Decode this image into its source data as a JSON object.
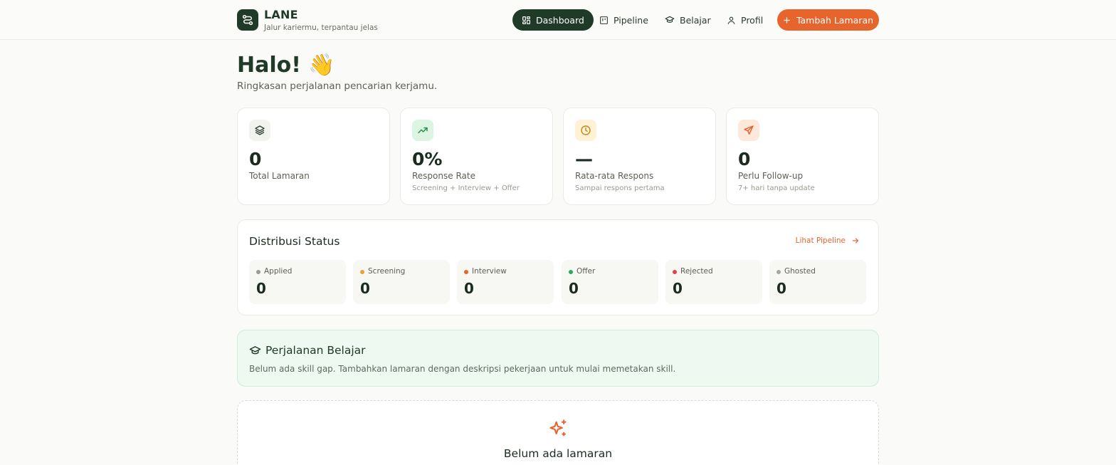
{
  "brand": {
    "name": "LANE",
    "tagline": "Jalur kariermu, terpantau jelas"
  },
  "nav": {
    "items": [
      {
        "label": "Dashboard",
        "icon": "dashboard-grid-icon",
        "active": true
      },
      {
        "label": "Pipeline",
        "icon": "kanban-icon",
        "active": false
      },
      {
        "label": "Belajar",
        "icon": "graduation-cap-icon",
        "active": false
      },
      {
        "label": "Profil",
        "icon": "user-icon",
        "active": false
      }
    ],
    "cta": {
      "label": "Tambah Lamaran",
      "icon": "plus-icon"
    }
  },
  "greeting": {
    "title": "Halo! 👋",
    "subtitle": "Ringkasan perjalanan pencarian kerjamu."
  },
  "stats": [
    {
      "value": "0",
      "label": "Total Lamaran",
      "sub": "",
      "icon": "layers-icon"
    },
    {
      "value": "0%",
      "label": "Response Rate",
      "sub": "Screening + Interview + Offer",
      "icon": "trending-up-icon"
    },
    {
      "value": "—",
      "label": "Rata-rata Respons",
      "sub": "Sampai respons pertama",
      "icon": "clock-icon"
    },
    {
      "value": "0",
      "label": "Perlu Follow-up",
      "sub": "7+ hari tanpa update",
      "icon": "send-icon"
    }
  ],
  "distribution": {
    "title": "Distribusi Status",
    "link": "Lihat Pipeline",
    "statuses": [
      {
        "label": "Applied",
        "value": "0",
        "color": "#9a9a9a"
      },
      {
        "label": "Screening",
        "value": "0",
        "color": "#f0a030"
      },
      {
        "label": "Interview",
        "value": "0",
        "color": "#e8642d"
      },
      {
        "label": "Offer",
        "value": "0",
        "color": "#2faa5a"
      },
      {
        "label": "Rejected",
        "value": "0",
        "color": "#e04545"
      },
      {
        "label": "Ghosted",
        "value": "0",
        "color": "#a8a8a0"
      }
    ]
  },
  "learning": {
    "title": "Perjalanan Belajar",
    "description": "Belum ada skill gap. Tambahkan lamaran dengan deskripsi pekerjaan untuk mulai memetakan skill."
  },
  "empty_state": {
    "title": "Belum ada lamaran",
    "icon": "sparkles-icon"
  },
  "colors": {
    "brand": "#1f3a26",
    "accent": "#e8642d",
    "learn_bg": "#eef9f1"
  }
}
